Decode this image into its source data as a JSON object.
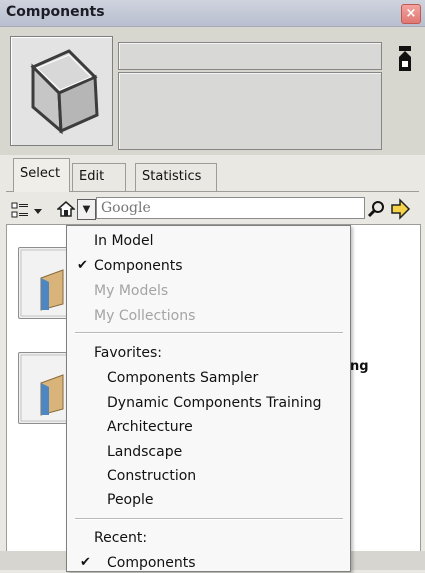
{
  "window": {
    "title": "Components",
    "close_glyph": "×"
  },
  "preview": {
    "name_value": "",
    "description_value": ""
  },
  "tabs": [
    {
      "label": "Select",
      "active": true
    },
    {
      "label": "Edit",
      "active": false
    },
    {
      "label": "Statistics",
      "active": false
    }
  ],
  "toolbar": {
    "view_icon": "list-view-icon",
    "home_icon": "home-icon",
    "search_placeholder": "Google",
    "search_icon": "magnifier-icon",
    "nav_icon": "arrow-right-icon"
  },
  "behind_text": "ng",
  "dropdown": {
    "top_items": [
      {
        "label": "In Model",
        "checked": false,
        "disabled": false
      },
      {
        "label": "Components",
        "checked": true,
        "disabled": false
      },
      {
        "label": "My Models",
        "checked": false,
        "disabled": true
      },
      {
        "label": "My Collections",
        "checked": false,
        "disabled": true
      }
    ],
    "favorites_header": "Favorites:",
    "favorites": [
      "Components Sampler",
      "Dynamic Components Training",
      "Architecture",
      "Landscape",
      "Construction",
      "People"
    ],
    "recent_header": "Recent:",
    "recent": [
      {
        "label": "Components",
        "checked": true
      }
    ]
  },
  "colors": {
    "menu_bg": "#f8f8f8",
    "panel_bg": "#e9e8e2",
    "disabled": "#a4a4a4"
  }
}
